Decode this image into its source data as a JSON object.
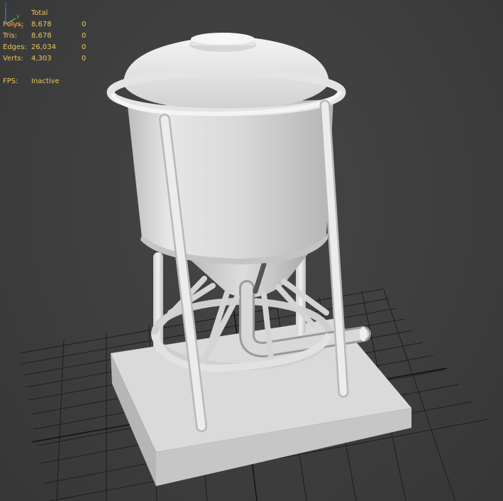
{
  "stats": {
    "header": "Total",
    "rows": [
      {
        "label": "Polys:",
        "total": "8,678",
        "selected": "0"
      },
      {
        "label": "Tris:",
        "total": "8,678",
        "selected": "0"
      },
      {
        "label": "Edges:",
        "total": "26,034",
        "selected": "0"
      },
      {
        "label": "Verts:",
        "total": "4,303",
        "selected": "0"
      }
    ],
    "fps_label": "FPS:",
    "fps_value": "Inactive"
  },
  "gizmo": {
    "axes": [
      "z",
      "x",
      "y"
    ],
    "colors": {
      "z": "#3d6fd6",
      "x": "#d04a3a",
      "y": "#4ab04a"
    }
  },
  "scene": {
    "object": "silo-model",
    "colors": {
      "background": "#404040",
      "grid": "#1c1c1c",
      "model": "#dcdcdc",
      "model_shadow": "#a8a8a8"
    }
  }
}
